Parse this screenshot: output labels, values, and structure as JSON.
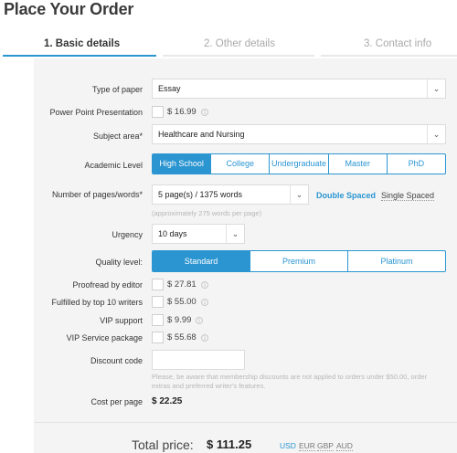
{
  "page": {
    "title": "Place Your Order"
  },
  "steps": [
    {
      "label": "1. Basic details",
      "active": true
    },
    {
      "label": "2. Other details",
      "active": false
    },
    {
      "label": "3. Contact info",
      "active": false
    }
  ],
  "colors": {
    "accent": "#2a95d1",
    "form_bg": "#f4f4f4",
    "step_inactive_line": "#e8e8e8"
  },
  "form": {
    "type_of_paper": {
      "label": "Type of paper",
      "value": "Essay"
    },
    "powerpoint": {
      "label": "Power Point Presentation",
      "price": "$ 16.99",
      "checked": false
    },
    "subject_area": {
      "label": "Subject area*",
      "value": "Healthcare and Nursing"
    },
    "academic_level": {
      "label": "Academic Level",
      "options": [
        "High School",
        "College",
        "Undergraduate",
        "Master",
        "PhD"
      ],
      "selected": "High School"
    },
    "pages": {
      "label": "Number of pages/words*",
      "value": "5 page(s) / 1375 words",
      "hint": "(approximately 275 words per page)",
      "spacing_selected": "Double Spaced",
      "spacing_other": "Single Spaced"
    },
    "urgency": {
      "label": "Urgency",
      "value": "10 days"
    },
    "quality_level": {
      "label": "Quality level:",
      "options": [
        "Standard",
        "Premium",
        "Platinum"
      ],
      "selected": "Standard"
    },
    "extras": [
      {
        "label": "Proofread by editor",
        "price": "$ 27.81"
      },
      {
        "label": "Fulfilled by top 10 writers",
        "price": "$ 55.00"
      },
      {
        "label": "VIP support",
        "price": "$ 9.99"
      },
      {
        "label": "VIP Service package",
        "price": "$ 55.68"
      }
    ],
    "discount": {
      "label": "Discount code",
      "value": "",
      "hint_line1": "Please, be aware that membership discounts are not applied to orders under $50.00, order",
      "hint_line2": "extras and preferred writer's features."
    },
    "cost_per_page": {
      "label": "Cost per page",
      "value": "$ 22.25"
    }
  },
  "total": {
    "label": "Total price:",
    "value": "$ 111.25",
    "currencies": [
      "USD",
      "EUR",
      "GBP",
      "AUD"
    ],
    "selected_currency": "USD"
  },
  "icons": {
    "dropdown": "chevron-down-icon",
    "info": "info-icon"
  }
}
